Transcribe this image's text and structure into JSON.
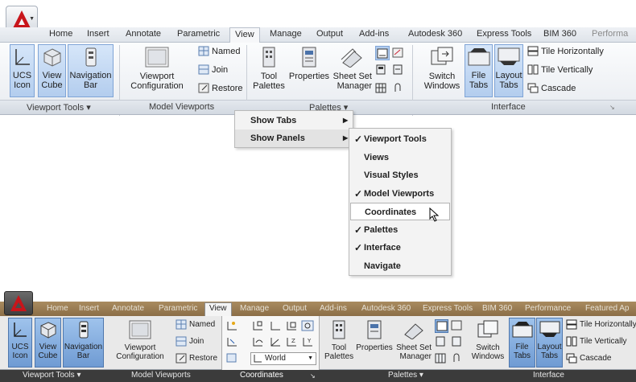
{
  "top": {
    "tabs": [
      "Home",
      "Insert",
      "Annotate",
      "Parametric",
      "View",
      "Manage",
      "Output",
      "Add-ins",
      "Autodesk 360",
      "Express Tools",
      "BIM 360",
      "Performa"
    ],
    "active_tab": "View",
    "buttons": {
      "ucs_icon": "UCS\nIcon",
      "view_cube": "View\nCube",
      "navigation_bar": "Navigation\nBar",
      "viewport_configuration": "Viewport\nConfiguration",
      "named": "Named",
      "join": "Join",
      "restore": "Restore",
      "tool_palettes": "Tool\nPalettes",
      "properties": "Properties",
      "sheet_set_manager": "Sheet Set\nManager",
      "switch_windows": "Switch\nWindows",
      "file_tabs": "File\nTabs",
      "layout_tabs": "Layout\nTabs",
      "tile_horizontally": "Tile Horizontally",
      "tile_vertically": "Tile Vertically",
      "cascade": "Cascade"
    },
    "panel_titles": {
      "viewport_tools": "Viewport Tools ▾",
      "model_viewports": "Model Viewports",
      "palettes": "Palettes ▾",
      "interface": "Interface"
    }
  },
  "menu": {
    "items": [
      "Show Tabs",
      "Show Panels"
    ],
    "submenu": [
      {
        "label": "Viewport Tools",
        "checked": true
      },
      {
        "label": "Views",
        "checked": false
      },
      {
        "label": "Visual Styles",
        "checked": false
      },
      {
        "label": "Model Viewports",
        "checked": true
      },
      {
        "label": "Coordinates",
        "checked": false,
        "hovered": true
      },
      {
        "label": "Palettes",
        "checked": true
      },
      {
        "label": "Interface",
        "checked": true
      },
      {
        "label": "Navigate",
        "checked": false
      }
    ]
  },
  "bottom": {
    "tabs": [
      "Home",
      "Insert",
      "Annotate",
      "Parametric",
      "View",
      "Manage",
      "Output",
      "Add-ins",
      "Autodesk 360",
      "Express Tools",
      "BIM 360",
      "Performance",
      "Featured Ap"
    ],
    "active_tab": "View",
    "world_combo": "World",
    "panel_titles": {
      "viewport_tools": "Viewport Tools ▾",
      "model_viewports": "Model Viewports",
      "coordinates": "Coordinates",
      "palettes": "Palettes ▾",
      "interface": "Interface"
    }
  },
  "colors": {
    "accent": "#c8151b",
    "selected_blue": "#b3cdee",
    "dark_title": "#3b3b3b"
  }
}
